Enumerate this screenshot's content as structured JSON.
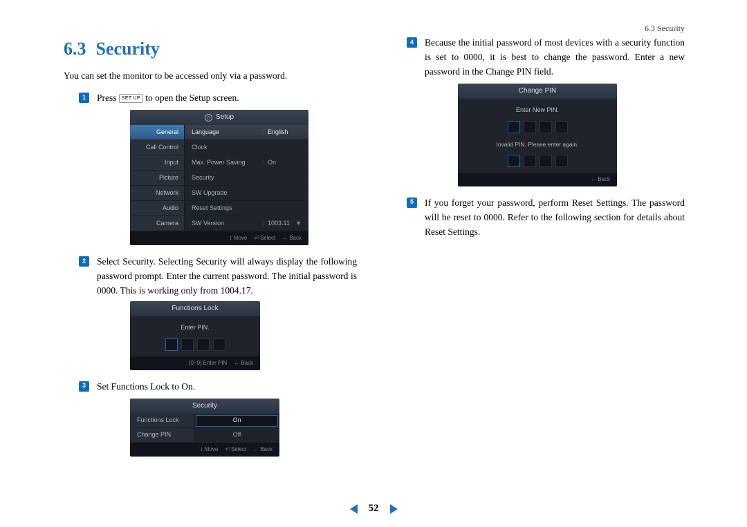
{
  "header": {
    "breadcrumb": "6.3 Security"
  },
  "section": {
    "number": "6.3",
    "title": "Security"
  },
  "intro": "You can set the monitor to be accessed only via a password.",
  "steps": {
    "s1_a": "Press ",
    "s1_key": "SET UP",
    "s1_b": " to open the Setup screen.",
    "s2": "Select Security. Selecting Security will always display the following password prompt. Enter the current password. The initial password is 0000. This is working only from 1004.17.",
    "s3": "Set Functions Lock to On.",
    "s4": "Because the initial password of most devices with a security function is set to 0000, it is best to change the password. Enter a new password in the Change PIN field.",
    "s5": "If you forget your password, perform Reset Settings. The password will be reset to 0000. Refer to the following section for details about Reset Settings."
  },
  "osd_setup": {
    "title": "Setup",
    "side": [
      "General",
      "Call Control",
      "Input",
      "Picture",
      "Network",
      "Audio",
      "Camera"
    ],
    "rows": [
      {
        "label": "Language",
        "value": "English"
      },
      {
        "label": "Clock",
        "value": ""
      },
      {
        "label": "Max. Power Saving",
        "value": "On"
      },
      {
        "label": "Security",
        "value": ""
      },
      {
        "label": "SW Upgrade",
        "value": ""
      },
      {
        "label": "Reset Settings",
        "value": ""
      },
      {
        "label": "SW Version",
        "value": "1003.11"
      }
    ],
    "footer": {
      "move": "Move",
      "select": "Select",
      "back": "Back"
    }
  },
  "osd_lock": {
    "title": "Functions Lock",
    "prompt": "Enter PIN.",
    "footer": {
      "hint": "[0~9] Enter PIN",
      "back": "Back"
    }
  },
  "osd_security": {
    "title": "Security",
    "left": [
      "Functions Lock",
      "Change PIN"
    ],
    "options": [
      "On",
      "Off"
    ],
    "footer": {
      "move": "Move",
      "select": "Select",
      "back": "Back"
    }
  },
  "osd_change": {
    "title": "Change PIN",
    "prompt": "Enter New PIN.",
    "invalid": "Invalid PIN. Please enter again.",
    "footer": {
      "back": "Back"
    }
  },
  "pager": {
    "page": "52"
  }
}
